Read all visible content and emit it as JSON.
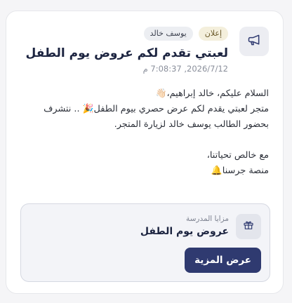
{
  "post": {
    "type_badge": "إعلان",
    "author_badge": "يوسف خالد",
    "title": "لعبتي تقدم لكم عروض يوم الطفل",
    "date": "2026/7/12, 7:08:37 م",
    "body": "السلام عليكم، خالد إبراهيم،👋🏻\nمتجر لعبتي يقدم لكم عرض حصري بيوم الطفل🎉 .. نتشرف\nبحضور الطالب يوسف خالد لزيارة المتجر.\n\nمع خالص تحياتنا،\nمنصة جرسنا🔔"
  },
  "perk": {
    "label": "مزايا المدرسة",
    "name": "عروض يوم الطفل",
    "button_label": "عرض المزية"
  },
  "icons": {
    "post_icon": "megaphone-icon",
    "perk_icon": "gift-icon"
  },
  "colors": {
    "accent": "#2f3a70",
    "type_badge_bg": "#f4efdc"
  }
}
